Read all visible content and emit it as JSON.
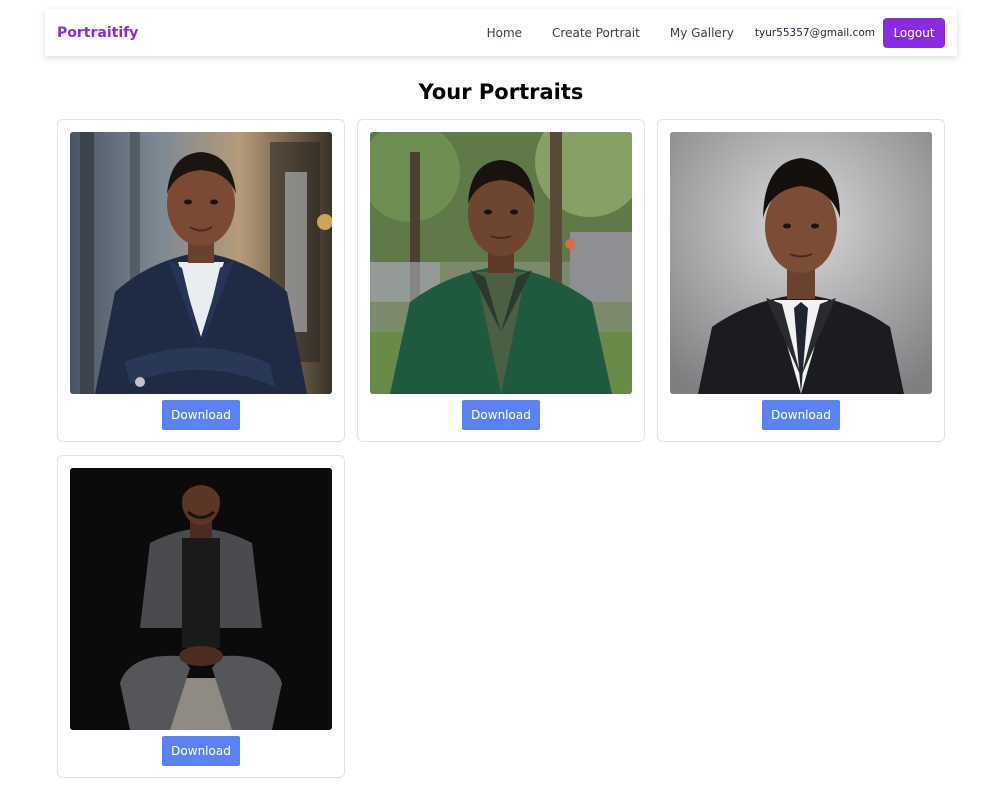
{
  "brand": "Portraitify",
  "nav": {
    "links": [
      "Home",
      "Create Portrait",
      "My Gallery"
    ],
    "user_email": "tyur55357@gmail.com",
    "logout_label": "Logout"
  },
  "page_title": "Your Portraits",
  "portraits": [
    {
      "download_label": "Download",
      "scene": "office background, navy suit, arms crossed"
    },
    {
      "download_label": "Download",
      "scene": "outdoor street with trees, green suit"
    },
    {
      "download_label": "Download",
      "scene": "gray studio backdrop, black suit and tie"
    },
    {
      "download_label": "Download",
      "scene": "dark studio, gray suit, seated on stool"
    }
  ],
  "colors": {
    "brand": "#8a2be2",
    "logout_bg": "#8a2be2",
    "download_bg": "#5b82f5",
    "card_border": "#e1e3e8"
  }
}
